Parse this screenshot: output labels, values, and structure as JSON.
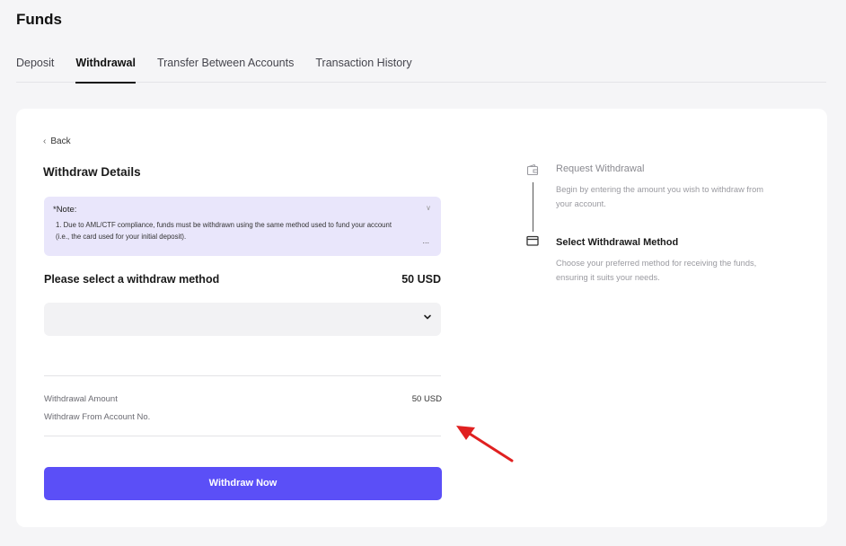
{
  "page": {
    "title": "Funds"
  },
  "tabs": [
    {
      "label": "Deposit",
      "active": false
    },
    {
      "label": "Withdrawal",
      "active": true
    },
    {
      "label": "Transfer Between Accounts",
      "active": false
    },
    {
      "label": "Transaction History",
      "active": false
    }
  ],
  "form": {
    "back_label": "Back",
    "section_title": "Withdraw Details",
    "note": {
      "title": "*Note:",
      "text": "1. Due to AML/CTF compliance, funds must be withdrawn using the same method used to fund your account (i.e., the card used for your initial deposit).",
      "more": "..."
    },
    "method_label": "Please select a withdraw method",
    "method_amount": "50 USD",
    "select_value": "",
    "summary": {
      "amount_label": "Withdrawal Amount",
      "amount_value": "50 USD",
      "account_label": "Withdraw From Account No."
    },
    "submit_label": "Withdraw Now"
  },
  "steps": [
    {
      "title": "Request Withdrawal",
      "desc": "Begin by entering the amount you wish to withdraw from your account.",
      "icon": "wallet-icon",
      "current": false
    },
    {
      "title": "Select Withdrawal Method",
      "desc": "Choose your preferred method for receiving the funds, ensuring it suits your needs.",
      "icon": "card-icon",
      "current": true
    }
  ],
  "colors": {
    "accent": "#5b4ff7",
    "note_bg": "#e9e6fb",
    "annotation": "#e02020"
  }
}
